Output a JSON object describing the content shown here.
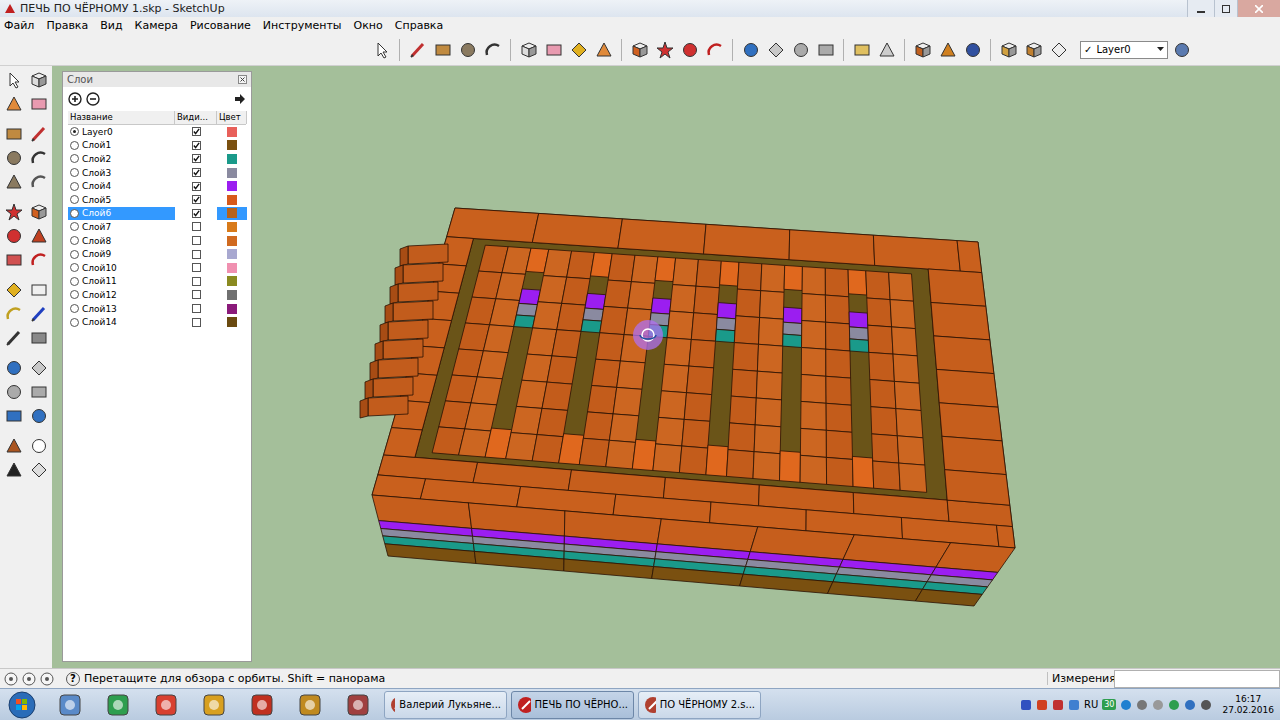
{
  "window": {
    "title": "ПЕЧЬ ПО ЧЁРНОМУ 1.skp - SketchUp"
  },
  "menu": [
    "Файл",
    "Правка",
    "Вид",
    "Камера",
    "Рисование",
    "Инструменты",
    "Окно",
    "Справка"
  ],
  "toolbar": {
    "layer_select": {
      "check": "✓",
      "value": "Layer0"
    }
  },
  "layers_panel": {
    "title": "Слои",
    "columns": [
      "Название",
      "Види...",
      "Цвет"
    ],
    "layers": [
      {
        "name": "Layer0",
        "active": true,
        "visible": true,
        "selected": false,
        "color": "#e8605a"
      },
      {
        "name": "Слой1",
        "active": false,
        "visible": true,
        "selected": false,
        "color": "#7a5010"
      },
      {
        "name": "Слой2",
        "active": false,
        "visible": true,
        "selected": false,
        "color": "#1a9a8a"
      },
      {
        "name": "Слой3",
        "active": false,
        "visible": true,
        "selected": false,
        "color": "#8a8aa0"
      },
      {
        "name": "Слой4",
        "active": false,
        "visible": true,
        "selected": false,
        "color": "#9b1ef0"
      },
      {
        "name": "Слой5",
        "active": false,
        "visible": true,
        "selected": false,
        "color": "#d85a1a"
      },
      {
        "name": "Слой6",
        "active": false,
        "visible": true,
        "selected": true,
        "color": "#b8621a"
      },
      {
        "name": "Слой7",
        "active": false,
        "visible": false,
        "selected": false,
        "color": "#d87a1a"
      },
      {
        "name": "Слой8",
        "active": false,
        "visible": false,
        "selected": false,
        "color": "#d06a20"
      },
      {
        "name": "Слой9",
        "active": false,
        "visible": false,
        "selected": false,
        "color": "#a8a8d0"
      },
      {
        "name": "Слой10",
        "active": false,
        "visible": false,
        "selected": false,
        "color": "#f090b0"
      },
      {
        "name": "Слой11",
        "active": false,
        "visible": false,
        "selected": false,
        "color": "#8a8a20"
      },
      {
        "name": "Слой12",
        "active": false,
        "visible": false,
        "selected": false,
        "color": "#707070"
      },
      {
        "name": "Слой13",
        "active": false,
        "visible": false,
        "selected": false,
        "color": "#8a1a7a"
      },
      {
        "name": "Слой14",
        "active": false,
        "visible": false,
        "selected": false,
        "color": "#6a4a10"
      }
    ]
  },
  "status_bar": {
    "help": "?",
    "message": "Перетащите для обзора с орбиты. Shift = панорама",
    "measurements_label": "Измерения"
  },
  "taskbar": {
    "tasks": [
      {
        "label": "Валерий Лукьяне...",
        "selected": false
      },
      {
        "label": "ПЕЧЬ ПО ЧЁРНО...",
        "selected": true
      },
      {
        "label": "ПО ЧЁРНОМУ 2.s...",
        "selected": false
      }
    ],
    "tray": {
      "badge": "30",
      "language": "RU",
      "time": "16:17",
      "date": "27.02.2016"
    }
  }
}
